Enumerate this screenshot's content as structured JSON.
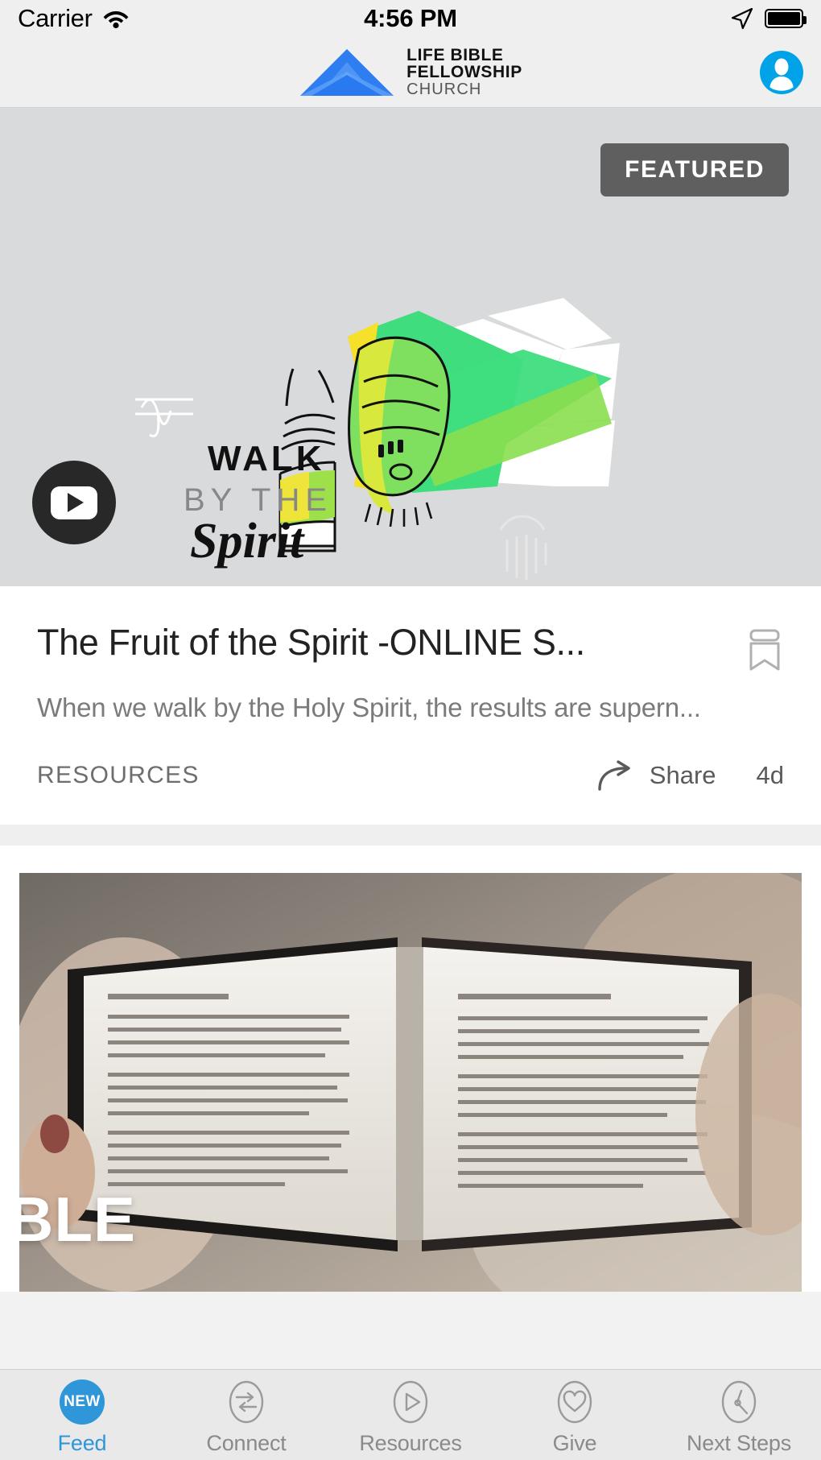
{
  "status_bar": {
    "carrier": "Carrier",
    "wifi_icon": "wifi-icon",
    "time": "4:56 PM",
    "location_icon": "location-arrow-icon",
    "battery_icon": "battery-full-icon"
  },
  "nav_bar": {
    "logo_icon": "church-arrow-logo-icon",
    "brand_line1": "LIFE BIBLE",
    "brand_line2": "FELLOWSHIP",
    "brand_line3": "CHURCH",
    "avatar_icon": "user-avatar-icon"
  },
  "featured_post": {
    "badge": "FEATURED",
    "play_icon": "youtube-play-icon",
    "artwork_text": {
      "walk": "WALK",
      "by_the": "BY THE",
      "spirit": "Spirit"
    },
    "title": "The Fruit of the Spirit -ONLINE S...",
    "bookmark_icon": "bookmark-icon",
    "description": "When we walk by the Holy Spirit, the results are supern...",
    "category": "RESOURCES",
    "share_icon": "share-arrow-icon",
    "share_label": "Share",
    "timestamp": "4d"
  },
  "second_post": {
    "image_icon": "open-bible-photo",
    "overlay_text": "BLE"
  },
  "tab_bar": {
    "tabs": [
      {
        "label": "Feed",
        "icon": "new-badge-icon",
        "active": true
      },
      {
        "label": "Connect",
        "icon": "two-way-arrows-icon",
        "active": false
      },
      {
        "label": "Resources",
        "icon": "play-circle-icon",
        "active": false
      },
      {
        "label": "Give",
        "icon": "heart-circle-icon",
        "active": false
      },
      {
        "label": "Next Steps",
        "icon": "compass-circle-icon",
        "active": false
      }
    ],
    "new_badge_text": "NEW"
  },
  "colors": {
    "accent_blue": "#2e96d9",
    "logo_blue": "#2979f0",
    "logo_blue_light": "#4d94f5",
    "badge_gray": "#5f5f5f",
    "artwork_green": "#3fdd7e",
    "artwork_yellow": "#f5e02a"
  }
}
